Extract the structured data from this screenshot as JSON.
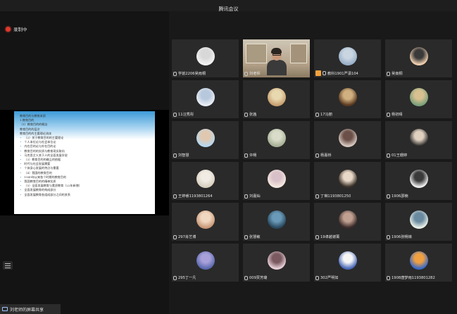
{
  "window": {
    "title": "腾讯会议"
  },
  "recording": {
    "label": "录制中"
  },
  "share_bar": {
    "label": "刘老师的屏幕共享"
  },
  "slide": {
    "lines": [
      {
        "text": "教育目的与教育本质",
        "bullet": false
      },
      {
        "text": "1.教育目的",
        "bullet": false
      },
      {
        "text": "（1）教育目的的概念",
        "bullet": false
      },
      {
        "text": "教育目的的层次",
        "bullet": false
      },
      {
        "text": "教育目的的主要理论流派",
        "bullet": false
      },
      {
        "text": "（2）关于教育目的的主要理论",
        "bullet": true
      },
      {
        "text": "个人本位论与社会本位论",
        "bullet": true
      },
      {
        "text": "内在目的论与外在目的论",
        "bullet": true
      },
      {
        "text": "教育目的的实质与教育现实取向",
        "bullet": true
      },
      {
        "text": "马克思主义关于人的全面发展学说",
        "bullet": true
      },
      {
        "text": "（3）教育目的的确立的依据",
        "bullet": true
      },
      {
        "text": "时代与社会发展需要",
        "bullet": true
      },
      {
        "text": "个体身心发展的特点与需要",
        "bullet": true
      },
      {
        "text": "（4）我国的教育目的",
        "bullet": true
      },
      {
        "text": "1949年以来各个时期的教育目的",
        "bullet": true
      },
      {
        "text": "我国教育目的的精神实质",
        "bullet": true
      },
      {
        "text": "（5）全面发展教育与素质教育（22年新增）",
        "bullet": true
      },
      {
        "text": "全面发展教育的构成部分",
        "bullet": true
      },
      {
        "text": "全面发展教育各组成部分之间的关系",
        "bullet": true
      }
    ]
  },
  "participants": [
    {
      "name": "学前2206吴雨桐",
      "kind": "avatar",
      "colors": [
        "#f2f2f2",
        "#d8d8d8"
      ]
    },
    {
      "name": "刘老师",
      "kind": "video",
      "active": true
    },
    {
      "name": "教科1901严潇104",
      "kind": "avatar",
      "host": true,
      "colors": [
        "#9ab0c8",
        "#c9d6e2"
      ]
    },
    {
      "name": "吴南桐",
      "kind": "avatar",
      "colors": [
        "#f0d0b0",
        "#3a3a3a"
      ]
    },
    {
      "name": "11汪秀彤",
      "kind": "avatar",
      "colors": [
        "#e9eef5",
        "#b8c8dc"
      ]
    },
    {
      "name": "张茜",
      "kind": "avatar",
      "colors": [
        "#c8a070",
        "#e8d8b0"
      ]
    },
    {
      "name": "17冯丽",
      "kind": "avatar",
      "colors": [
        "#5a3a20",
        "#d0b080"
      ]
    },
    {
      "name": "杨初晴",
      "kind": "avatar",
      "colors": [
        "#7aa07a",
        "#d8c090"
      ]
    },
    {
      "name": "刘智慧",
      "kind": "avatar",
      "colors": [
        "#b8d8f0",
        "#e0c8b0"
      ]
    },
    {
      "name": "许畅",
      "kind": "avatar",
      "colors": [
        "#a8b098",
        "#d8dcc8"
      ]
    },
    {
      "name": "杨嘉桥",
      "kind": "avatar",
      "colors": [
        "#d8c8c0",
        "#6a5048"
      ]
    },
    {
      "name": "01王珊婷",
      "kind": "avatar",
      "colors": [
        "#2a2a2a",
        "#e0d0c0"
      ]
    },
    {
      "name": "王婷睿1193801264",
      "kind": "avatar",
      "colors": [
        "#d8d0c0",
        "#f0ece4"
      ]
    },
    {
      "name": "刘嘉灿",
      "kind": "avatar",
      "colors": [
        "#f5e8e0",
        "#d8c0c8"
      ]
    },
    {
      "name": "丁琳1193801250",
      "kind": "avatar",
      "colors": [
        "#3a3028",
        "#e8d8c8"
      ]
    },
    {
      "name": "1906邵楠",
      "kind": "avatar",
      "colors": [
        "#f0f0f0",
        "#3a3a3a"
      ]
    },
    {
      "name": "297肖艺博",
      "kind": "avatar",
      "colors": [
        "#c89878",
        "#f0d8c0"
      ]
    },
    {
      "name": "张慧敏",
      "kind": "avatar",
      "colors": [
        "#2a4a60",
        "#6a9ab8"
      ]
    },
    {
      "name": "19卓越谢菁",
      "kind": "avatar",
      "colors": [
        "#3a2a2a",
        "#c0a090"
      ]
    },
    {
      "name": "1906张畅婧",
      "kind": "avatar",
      "colors": [
        "#e8f0e8",
        "#6a8aa0"
      ]
    },
    {
      "name": "295丁一凡",
      "kind": "avatar",
      "colors": [
        "#5a6ab0",
        "#a8a0d8"
      ]
    },
    {
      "name": "009贾芳璐",
      "kind": "avatar",
      "colors": [
        "#e8d0d8",
        "#7a5a60"
      ]
    },
    {
      "name": "302严明如",
      "kind": "avatar",
      "colors": [
        "#4a6ab8",
        "#f5f5f5"
      ]
    },
    {
      "name": "1908唐梦雨1193801282",
      "kind": "avatar",
      "colors": [
        "#3a6ac8",
        "#f0a040"
      ]
    }
  ]
}
